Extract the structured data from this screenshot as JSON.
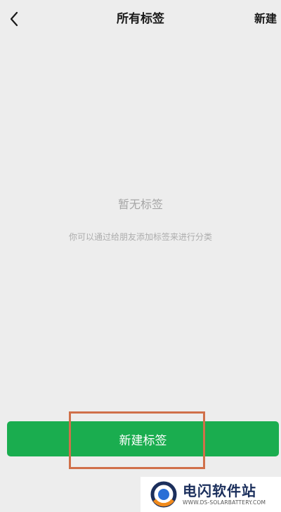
{
  "nav": {
    "back_icon": "chevron-left-icon",
    "title": "所有标签",
    "action_label": "新建"
  },
  "empty_state": {
    "title": "暂无标签",
    "hint": "你可以通过给朋友添加标签来进行分类"
  },
  "primary_button": {
    "label": "新建标签"
  },
  "highlight_color": "#d0704a",
  "button_color": "#1aad4f",
  "watermark": {
    "name": "电闪软件站",
    "url": "WWW.DS-SOLARBATTERY.COM",
    "logo_icon": "lightning-logo-icon"
  }
}
